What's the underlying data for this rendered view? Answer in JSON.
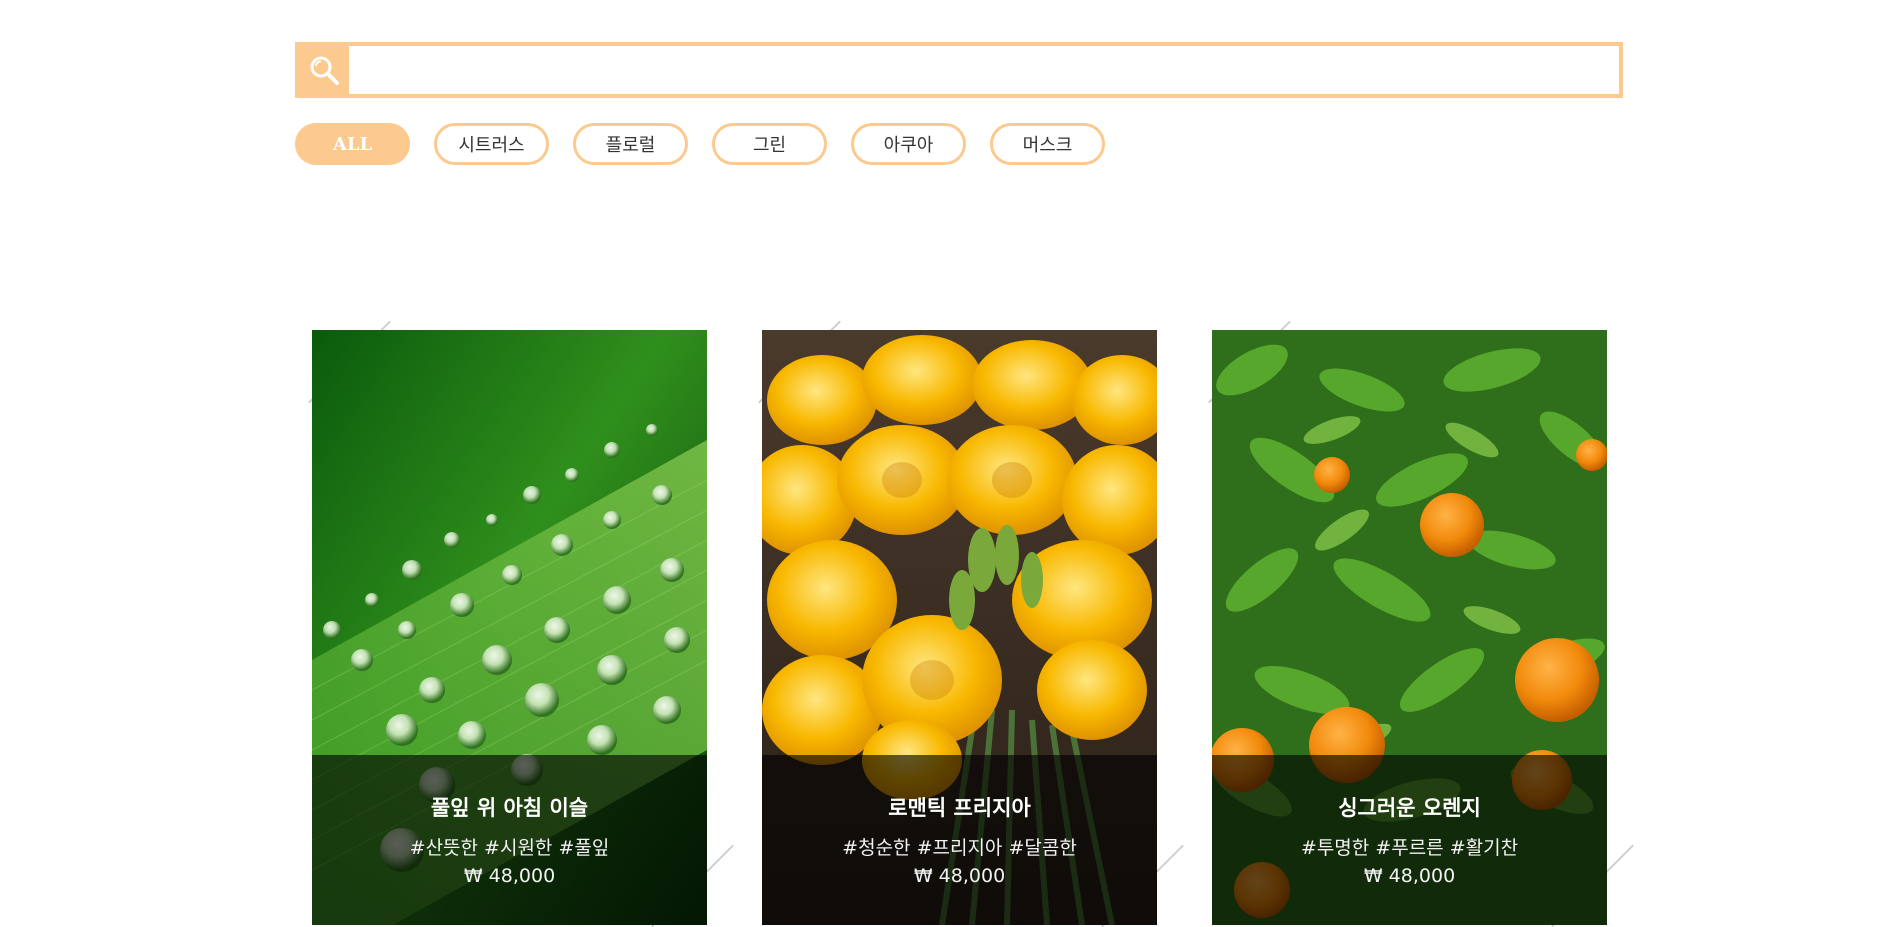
{
  "search": {
    "placeholder": "",
    "value": ""
  },
  "filters": [
    {
      "label": "ALL",
      "active": true
    },
    {
      "label": "시트러스",
      "active": false
    },
    {
      "label": "플로럴",
      "active": false
    },
    {
      "label": "그린",
      "active": false
    },
    {
      "label": "아쿠아",
      "active": false
    },
    {
      "label": "머스크",
      "active": false
    }
  ],
  "products": [
    {
      "title": "풀잎 위 아침 이슬",
      "tags": "#산뜻한 #시원한 #풀잎",
      "price": "₩ 48,000",
      "image": "dew-drops-on-grass-blade"
    },
    {
      "title": "로맨틱 프리지아",
      "tags": "#청순한 #프리지아 #달콤한",
      "price": "₩ 48,000",
      "image": "yellow-freesia-bouquet"
    },
    {
      "title": "싱그러운 오렌지",
      "tags": "#투명한 #푸르른 #활기찬",
      "price": "₩ 48,000",
      "image": "orange-tree-with-fruit"
    }
  ],
  "colors": {
    "accent": "#fcc98e"
  }
}
